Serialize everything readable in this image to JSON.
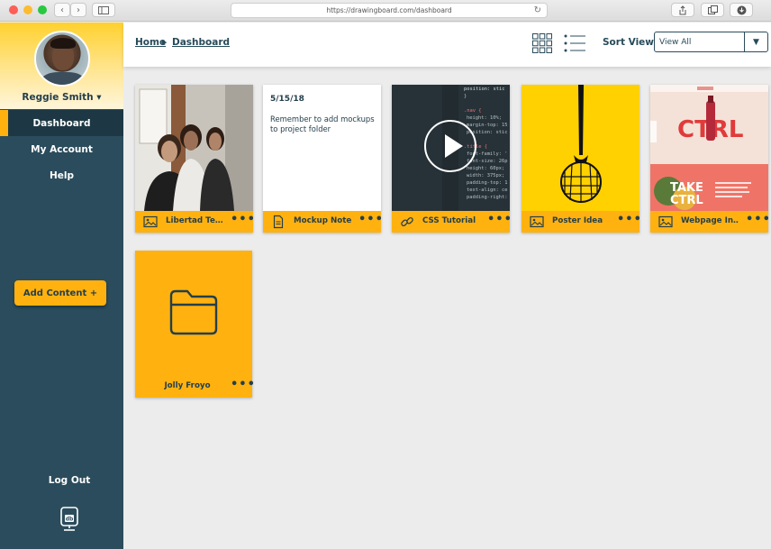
{
  "browser": {
    "url": "https://drawingboard.com/dashboard",
    "nav_back": "‹",
    "nav_forward": "›",
    "reload": "↻"
  },
  "user": {
    "name": "Reggie Smith ▾"
  },
  "sidebar": {
    "items": [
      {
        "label": "Dashboard",
        "active": true
      },
      {
        "label": "My Account",
        "active": false
      },
      {
        "label": "Help",
        "active": false
      }
    ],
    "add_content": "Add Content +",
    "logout": "Log Out",
    "logo_text": "db"
  },
  "header": {
    "breadcrumb": [
      "Home",
      "Dashboard"
    ],
    "sort_label": "Sort View:",
    "sort_value": "View All"
  },
  "cards": [
    {
      "type": "image",
      "icon": "image-icon",
      "title": "Libertad Te…"
    },
    {
      "type": "note",
      "icon": "document-icon",
      "title": "Mockup Note",
      "date": "5/15/18",
      "body": "Remember to add mockups to project folder"
    },
    {
      "type": "video",
      "icon": "link-icon",
      "title": "CSS Tutorial"
    },
    {
      "type": "image",
      "icon": "image-icon",
      "title": "Poster Idea"
    },
    {
      "type": "image",
      "icon": "image-icon",
      "title": "Webpage In…"
    }
  ],
  "folder": {
    "icon": "folder-icon",
    "title": "Jolly Froyo"
  },
  "more_dots": "•••",
  "colors": {
    "sidebar": "#2b4c5c",
    "accent": "#ffb20f",
    "text": "#243f4c"
  }
}
